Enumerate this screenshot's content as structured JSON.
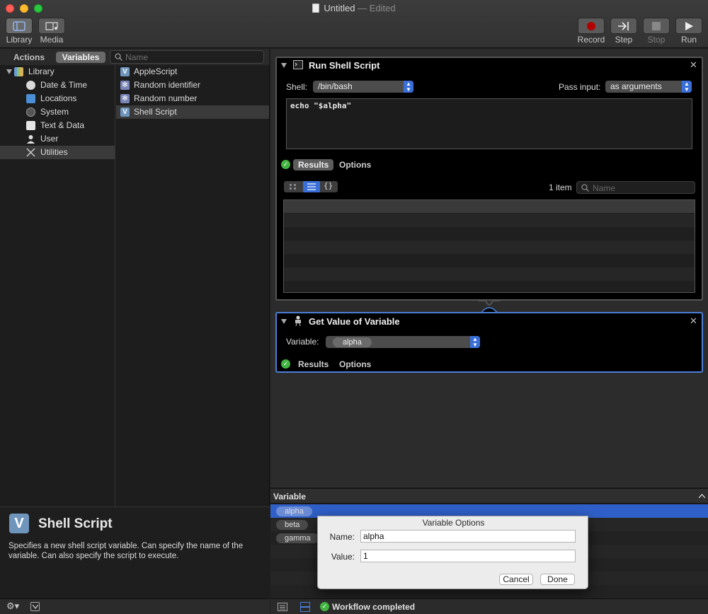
{
  "window": {
    "title": "Untitled",
    "edited": "— Edited"
  },
  "toolbar": {
    "library_label": "Library",
    "media_label": "Media",
    "record_label": "Record",
    "step_label": "Step",
    "stop_label": "Stop",
    "run_label": "Run"
  },
  "left": {
    "tabs": [
      "Actions",
      "Variables"
    ],
    "selected_tab": "Variables",
    "search_placeholder": "Name",
    "library_root": "Library",
    "categories": [
      "Date & Time",
      "Locations",
      "System",
      "Text & Data",
      "User",
      "Utilities"
    ],
    "selected_category": "Utilities",
    "items": [
      {
        "label": "AppleScript",
        "icon": "variable-icon"
      },
      {
        "label": "Random identifier",
        "icon": "gear-icon"
      },
      {
        "label": "Random number",
        "icon": "gear-icon"
      },
      {
        "label": "Shell Script",
        "icon": "variable-icon"
      }
    ],
    "selected_item": "Shell Script"
  },
  "description": {
    "icon_letter": "V",
    "title": "Shell Script",
    "text": "Specifies a new shell script variable. Can specify the name of the variable. Can also specify the script to execute."
  },
  "run_shell_script": {
    "title": "Run Shell Script",
    "shell_label": "Shell:",
    "shell_value": "/bin/bash",
    "pass_input_label": "Pass input:",
    "pass_input_value": "as arguments",
    "script": "echo \"$alpha\"",
    "results_tab": "Results",
    "options_tab": "Options",
    "item_count": "1 item",
    "search_placeholder": "Name",
    "json_view_label": "{}"
  },
  "get_value": {
    "title": "Get Value of Variable",
    "variable_label": "Variable:",
    "variable_value": "alpha",
    "results_tab": "Results",
    "options_tab": "Options"
  },
  "variables": {
    "header": "Variable",
    "items": [
      "alpha",
      "beta",
      "gamma"
    ],
    "selected": "alpha"
  },
  "dialog": {
    "title": "Variable Options",
    "name_label": "Name:",
    "name_value": "alpha",
    "value_label": "Value:",
    "value_value": "1",
    "cancel_label": "Cancel",
    "done_label": "Done"
  },
  "status": {
    "text": "Workflow completed"
  },
  "colors": {
    "accent": "#3a6fd8",
    "selection": "#2f5fc8",
    "success": "#42b441",
    "record": "#b30000"
  }
}
